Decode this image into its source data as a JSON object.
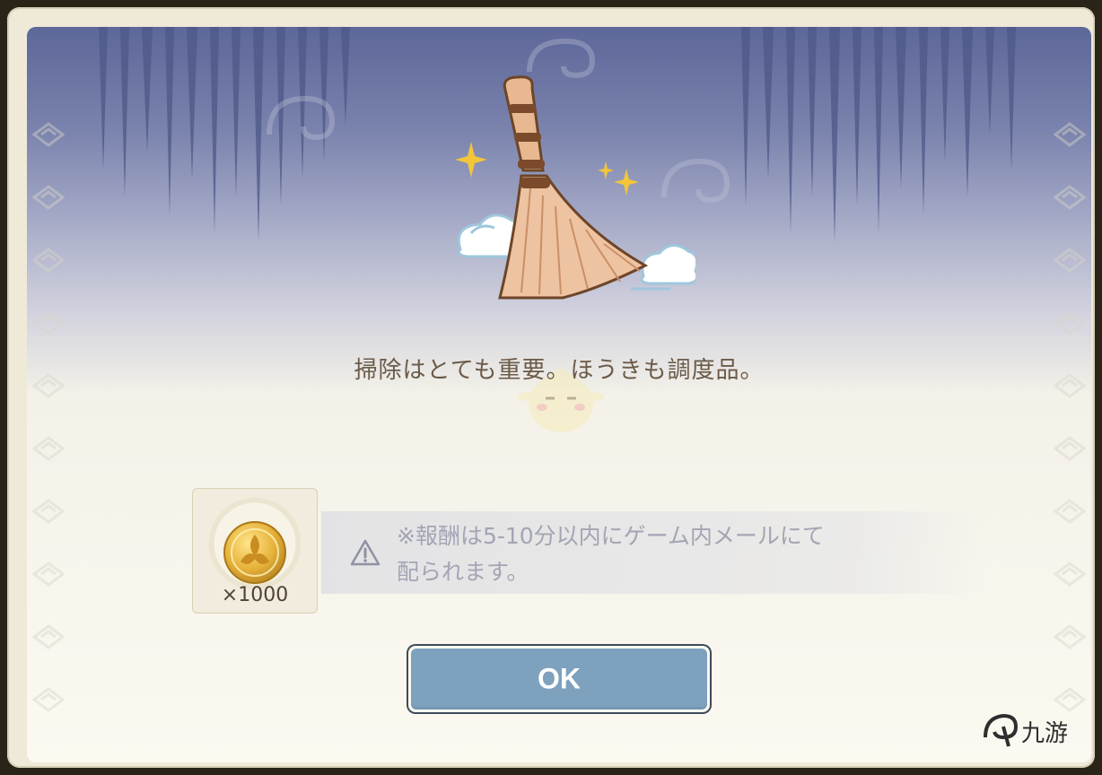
{
  "dialog": {
    "message": "掃除はとても重要。ほうきも調度品。",
    "reward": {
      "icon": "primogem-coin-icon",
      "quantity": "×1000"
    },
    "notice": {
      "icon": "warning-icon",
      "line1": "※報酬は5-10分以内にゲーム内メールにて",
      "line2": "配られます。"
    },
    "ok_label": "OK"
  },
  "watermark": {
    "icon": "9game-logo-icon",
    "text": "九游"
  },
  "colors": {
    "header_top": "#5d6799",
    "panel_bg": "#fbf9f0",
    "button_fill": "#7ea1be",
    "message_text": "#6b5a48",
    "notice_text": "#a3a5b4"
  }
}
